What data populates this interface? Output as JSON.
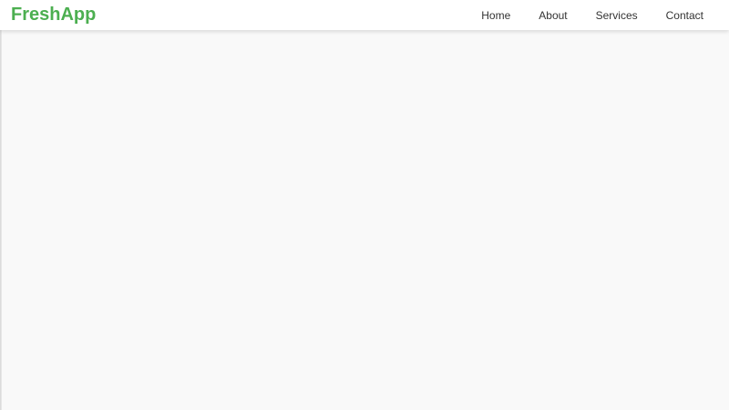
{
  "navbar": {
    "brand": "FreshApp",
    "brand_color": "#4caf50",
    "links": [
      {
        "label": "Home"
      },
      {
        "label": "About"
      },
      {
        "label": "Services"
      },
      {
        "label": "Contact"
      }
    ]
  }
}
